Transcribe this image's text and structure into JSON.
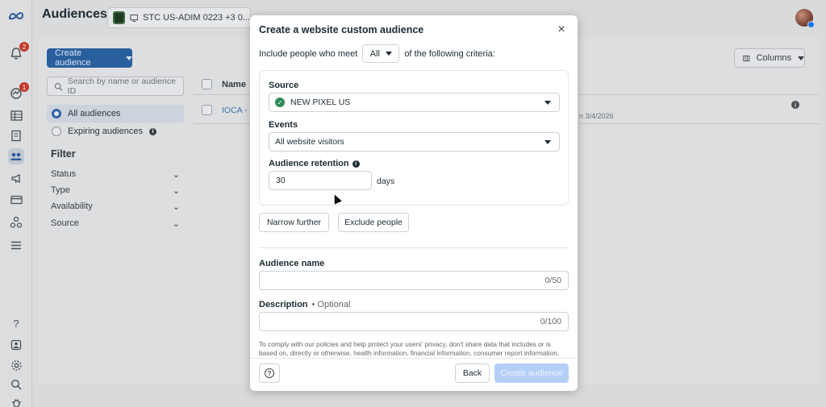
{
  "app": {
    "title": "Audiences",
    "account_label": "STC US-ADIM 0223 +3 0...",
    "rail_badges": {
      "notifications": "2",
      "ads": "1"
    }
  },
  "toolbar": {
    "create_label": "Create audience",
    "search_placeholder": "Search by name or audience ID",
    "columns_label": "Columns"
  },
  "sidebar": {
    "all_audiences": "All audiences",
    "expiring_audiences": "Expiring audiences",
    "filter_title": "Filter",
    "filters": [
      "Status",
      "Type",
      "Availability",
      "Source"
    ]
  },
  "table": {
    "name_header": "Name",
    "row_name": "IOCA - ",
    "row_date": "n 3/4/2026"
  },
  "modal": {
    "title": "Create a website custom audience",
    "criteria_prefix": "Include people who meet",
    "criteria_value": "All",
    "criteria_suffix": "of the following criteria:",
    "source_label": "Source",
    "source_value": "NEW PIXEL US",
    "events_label": "Events",
    "events_value": "All website visitors",
    "retention_label": "Audience retention",
    "retention_value": "30",
    "retention_unit": "days",
    "narrow_label": "Narrow further",
    "exclude_label": "Exclude people",
    "name_label": "Audience name",
    "name_counter": "0/50",
    "description_label": "Description",
    "description_optional": "• Optional",
    "description_counter": "0/100",
    "policy_text": "To comply with our policies and help protect your users' privacy, don't share data that includes or is based on, directly or otherwise, health information, financial information, consumer report information,",
    "back_label": "Back",
    "create_label": "Create audience"
  },
  "colors": {
    "primary_disabled": "#b4cff7",
    "success": "#2e8b57",
    "link": "#3c6fa8"
  }
}
